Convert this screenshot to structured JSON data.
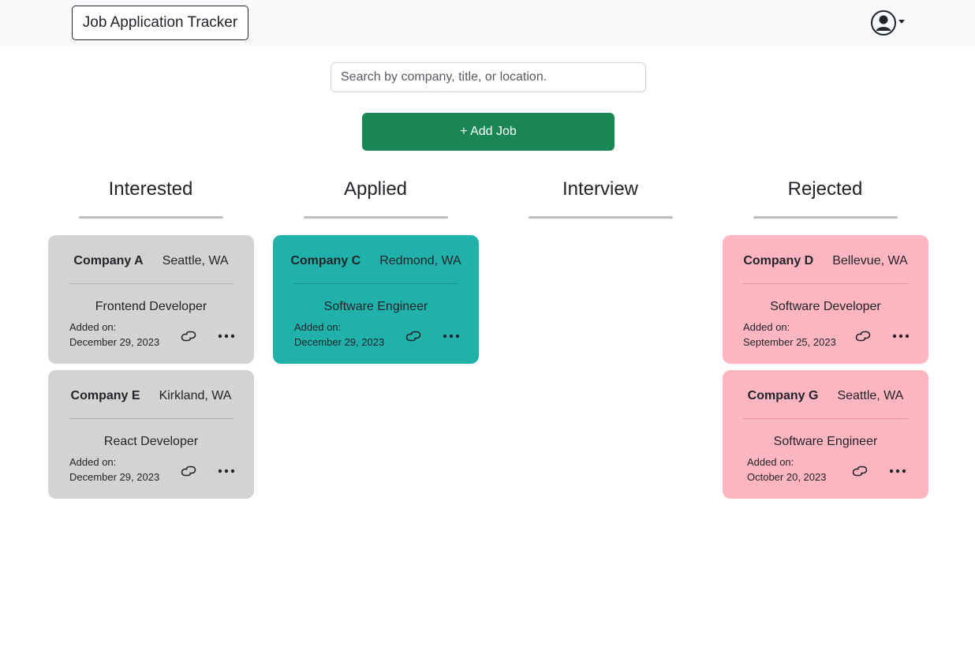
{
  "navbar": {
    "brand": "Job Application Tracker",
    "user_icon": "user-circle-icon"
  },
  "search": {
    "placeholder": "Search by company, title, or location.",
    "value": ""
  },
  "add_button": {
    "label": "+ Add Job"
  },
  "colors": {
    "interested": "#d3d3d3",
    "applied": "#20b2aa",
    "rejected": "#ffb6c1",
    "primary": "#198754"
  },
  "columns": [
    {
      "title": "Interested"
    },
    {
      "title": "Applied"
    },
    {
      "title": "Interview"
    },
    {
      "title": "Rejected"
    }
  ],
  "cards": [
    {
      "company": "Company A",
      "location": "Seattle, WA",
      "title": "Frontend Developer",
      "added_label": "Added on:",
      "date": "December 29, 2023"
    },
    {
      "company": "Company E",
      "location": "Kirkland, WA",
      "title": "React Developer",
      "added_label": "Added on:",
      "date": "December 29, 2023"
    },
    {
      "company": "Company C",
      "location": "Redmond, WA",
      "title": "Software Engineer",
      "added_label": "Added on:",
      "date": "December 29, 2023"
    },
    {
      "company": "Company D",
      "location": "Bellevue, WA",
      "title": "Software Developer",
      "added_label": "Added on:",
      "date": "September 25, 2023"
    },
    {
      "company": "Company G",
      "location": "Seattle, WA",
      "title": "Software Engineer",
      "added_label": "Added on:",
      "date": "October 20, 2023"
    }
  ]
}
